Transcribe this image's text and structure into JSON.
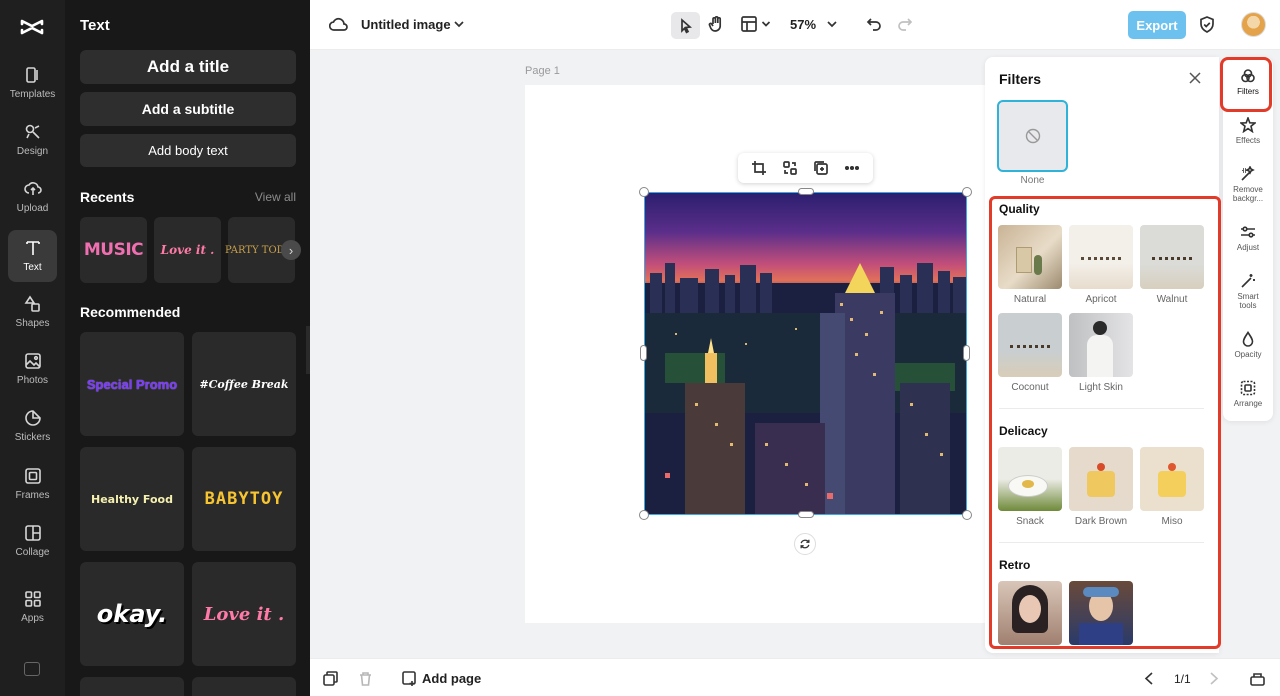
{
  "left_rail": {
    "items": [
      {
        "label": "Templates"
      },
      {
        "label": "Design"
      },
      {
        "label": "Upload"
      },
      {
        "label": "Text"
      },
      {
        "label": "Shapes"
      },
      {
        "label": "Photos"
      },
      {
        "label": "Stickers"
      },
      {
        "label": "Frames"
      },
      {
        "label": "Collage"
      },
      {
        "label": "Apps"
      }
    ],
    "active": "Text"
  },
  "text_panel": {
    "title": "Text",
    "add_title": "Add a title",
    "add_subtitle": "Add a subtitle",
    "add_body": "Add body text",
    "recents_heading": "Recents",
    "view_all": "View all",
    "recents": [
      "MUSIC",
      "Love it .",
      "PARTY TODAY"
    ],
    "recommended_heading": "Recommended",
    "recommended": [
      "Special Promo",
      "#Coffee Break",
      "Healthy Food",
      "BABYTOY",
      "okay.",
      "Love it ."
    ]
  },
  "topbar": {
    "doc_title": "Untitled image",
    "zoom": "57%",
    "export_label": "Export"
  },
  "canvas": {
    "page_label": "Page 1"
  },
  "filters_panel": {
    "title": "Filters",
    "none_label": "None",
    "sections": [
      {
        "name": "Quality",
        "items": [
          "Natural",
          "Apricot",
          "Walnut",
          "Coconut",
          "Light Skin"
        ]
      },
      {
        "name": "Delicacy",
        "items": [
          "Snack",
          "Dark Brown",
          "Miso"
        ]
      },
      {
        "name": "Retro",
        "items": []
      }
    ]
  },
  "right_rail": {
    "items": [
      {
        "label": "Filters"
      },
      {
        "label": "Effects"
      },
      {
        "label": "Remove backgr..."
      },
      {
        "label": "Adjust"
      },
      {
        "label": "Smart tools"
      },
      {
        "label": "Opacity"
      },
      {
        "label": "Arrange"
      }
    ],
    "active": "Filters"
  },
  "bottombar": {
    "add_page": "Add page",
    "pager": "1/1"
  },
  "colors": {
    "accent": "#6dc1ef",
    "selection": "#3ea8e0",
    "highlight": "#e23b2a"
  }
}
